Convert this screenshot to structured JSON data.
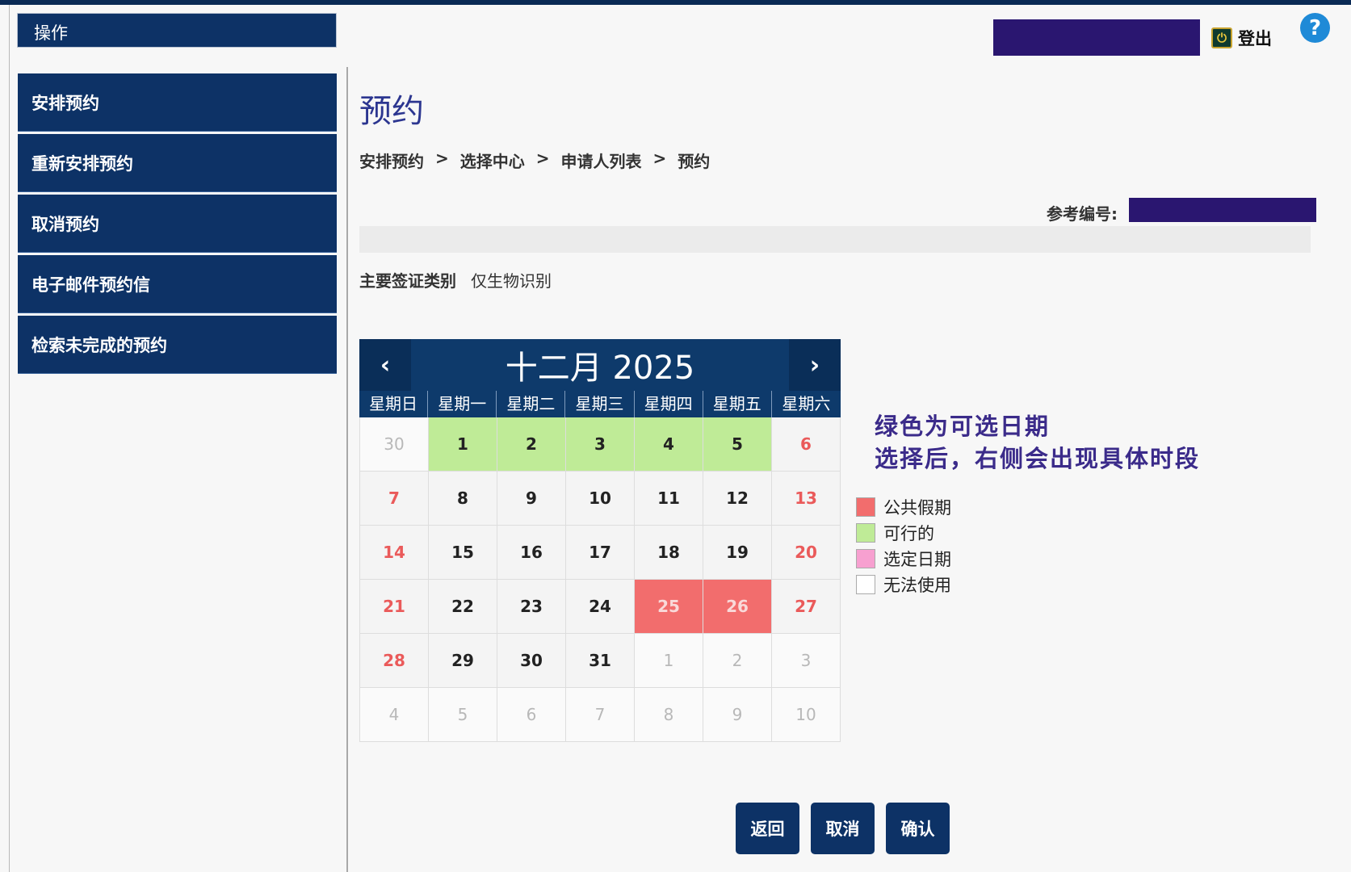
{
  "header": {
    "ops_label": "操作",
    "logout_label": "登出",
    "help_glyph": "?"
  },
  "sidebar": {
    "items": [
      {
        "label": "安排预约"
      },
      {
        "label": "重新安排预约"
      },
      {
        "label": "取消预约"
      },
      {
        "label": "电子邮件预约信"
      },
      {
        "label": "检索未完成的预约"
      }
    ]
  },
  "main": {
    "title": "预约",
    "breadcrumb": [
      "安排预约",
      "选择中心",
      "申请人列表",
      "预约"
    ],
    "breadcrumb_sep": ">",
    "ref_label": "参考编号:",
    "visa_label": "主要签证类别",
    "visa_value": "仅生物识别"
  },
  "calendar": {
    "prev_glyph": "‹",
    "next_glyph": "›",
    "title": "十二月 2025",
    "weekdays": [
      "星期日",
      "星期一",
      "星期二",
      "星期三",
      "星期四",
      "星期五",
      "星期六"
    ],
    "weeks": [
      [
        {
          "d": "30",
          "s": "other"
        },
        {
          "d": "1",
          "s": "available"
        },
        {
          "d": "2",
          "s": "available"
        },
        {
          "d": "3",
          "s": "available"
        },
        {
          "d": "4",
          "s": "available"
        },
        {
          "d": "5",
          "s": "available"
        },
        {
          "d": "6",
          "s": "weekend"
        }
      ],
      [
        {
          "d": "7",
          "s": "weekend"
        },
        {
          "d": "8",
          "s": ""
        },
        {
          "d": "9",
          "s": ""
        },
        {
          "d": "10",
          "s": ""
        },
        {
          "d": "11",
          "s": ""
        },
        {
          "d": "12",
          "s": ""
        },
        {
          "d": "13",
          "s": "weekend"
        }
      ],
      [
        {
          "d": "14",
          "s": "weekend"
        },
        {
          "d": "15",
          "s": ""
        },
        {
          "d": "16",
          "s": ""
        },
        {
          "d": "17",
          "s": ""
        },
        {
          "d": "18",
          "s": ""
        },
        {
          "d": "19",
          "s": ""
        },
        {
          "d": "20",
          "s": "weekend"
        }
      ],
      [
        {
          "d": "21",
          "s": "weekend"
        },
        {
          "d": "22",
          "s": ""
        },
        {
          "d": "23",
          "s": ""
        },
        {
          "d": "24",
          "s": ""
        },
        {
          "d": "25",
          "s": "holiday"
        },
        {
          "d": "26",
          "s": "holiday"
        },
        {
          "d": "27",
          "s": "weekend"
        }
      ],
      [
        {
          "d": "28",
          "s": "weekend"
        },
        {
          "d": "29",
          "s": ""
        },
        {
          "d": "30",
          "s": ""
        },
        {
          "d": "31",
          "s": ""
        },
        {
          "d": "1",
          "s": "other"
        },
        {
          "d": "2",
          "s": "other"
        },
        {
          "d": "3",
          "s": "other"
        }
      ],
      [
        {
          "d": "4",
          "s": "other"
        },
        {
          "d": "5",
          "s": "other"
        },
        {
          "d": "6",
          "s": "other"
        },
        {
          "d": "7",
          "s": "other"
        },
        {
          "d": "8",
          "s": "other"
        },
        {
          "d": "9",
          "s": "other"
        },
        {
          "d": "10",
          "s": "other"
        }
      ]
    ]
  },
  "annotation": {
    "line1": "绿色为可选日期",
    "line2": "选择后，右侧会出现具体时段"
  },
  "legend": [
    {
      "label": "公共假期",
      "color": "#f26d6d"
    },
    {
      "label": "可行的",
      "color": "#bfeb97"
    },
    {
      "label": "选定日期",
      "color": "#f7a0d0"
    },
    {
      "label": "无法使用",
      "color": "#ffffff"
    }
  ],
  "buttons": {
    "back": "返回",
    "cancel": "取消",
    "confirm": "确认"
  }
}
